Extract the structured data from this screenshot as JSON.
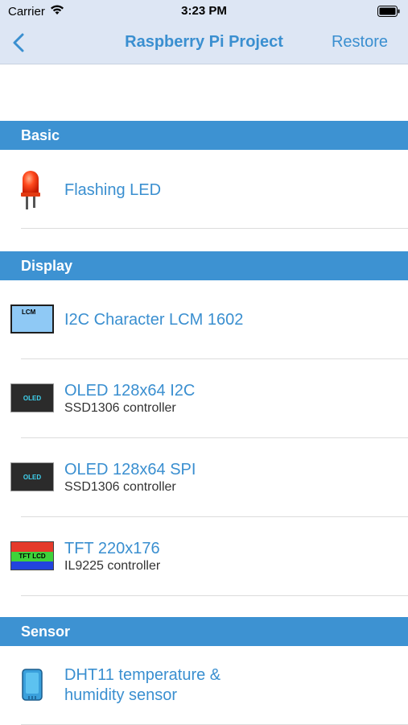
{
  "status_bar": {
    "carrier": "Carrier",
    "time": "3:23 PM"
  },
  "nav": {
    "title": "Raspberry Pi Project",
    "restore_label": "Restore",
    "back_icon": "chevron-left-icon"
  },
  "colors": {
    "accent": "#3a8fd0",
    "section_header_bg": "#3d92d2",
    "nav_bg": "#dde6f4"
  },
  "sections": {
    "basic": {
      "header": "Basic",
      "items": [
        {
          "title": "Flashing LED",
          "icon": "led-icon"
        }
      ]
    },
    "display": {
      "header": "Display",
      "items": [
        {
          "title": "I2C Character LCM 1602",
          "icon": "lcm-display-icon",
          "icon_text": "LCM"
        },
        {
          "title": "OLED 128x64 I2C",
          "subtitle": "SSD1306 controller",
          "icon": "oled-display-icon",
          "icon_text": "OLED"
        },
        {
          "title": "OLED 128x64 SPI",
          "subtitle": "SSD1306 controller",
          "icon": "oled-display-icon",
          "icon_text": "OLED"
        },
        {
          "title": "TFT 220x176",
          "subtitle": "IL9225 controller",
          "icon": "tft-display-icon",
          "icon_text": "TFT LCD"
        }
      ]
    },
    "sensor": {
      "header": "Sensor",
      "items": [
        {
          "title_line1": "DHT11 temperature &",
          "title_line2": "humidity sensor",
          "icon": "dht11-sensor-icon"
        }
      ]
    }
  }
}
